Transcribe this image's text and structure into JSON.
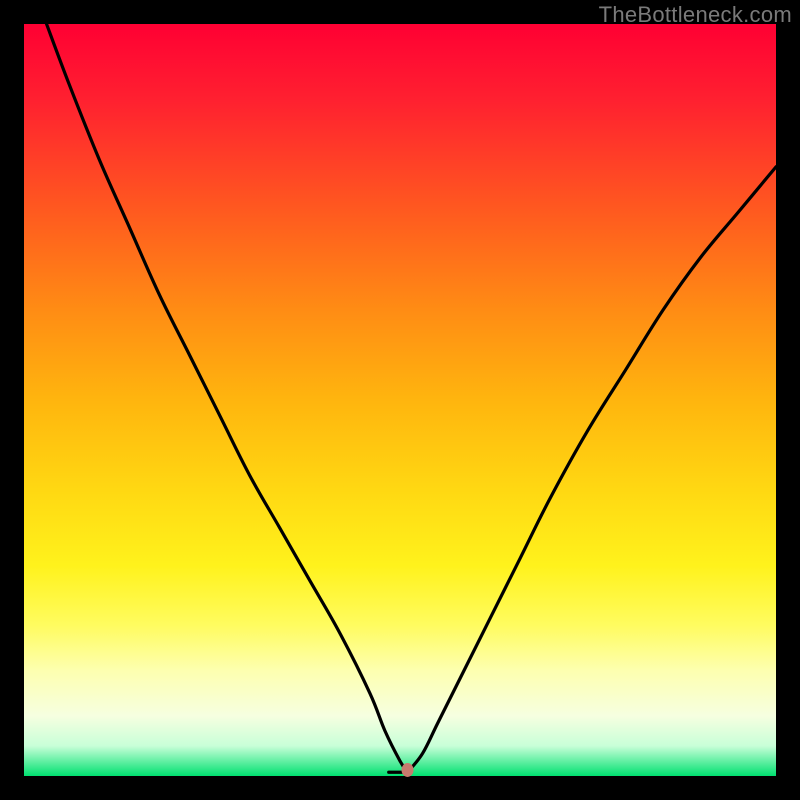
{
  "watermark": "TheBottleneck.com",
  "chart_data": {
    "type": "line",
    "title": "",
    "xlabel": "",
    "ylabel": "",
    "xlim": [
      0,
      100
    ],
    "ylim": [
      0,
      100
    ],
    "grid": false,
    "legend": false,
    "background_gradient": {
      "direction": "vertical",
      "stops": [
        {
          "pos": 0,
          "color": "#ff0033"
        },
        {
          "pos": 25,
          "color": "#ff7a18"
        },
        {
          "pos": 50,
          "color": "#ffc010"
        },
        {
          "pos": 72,
          "color": "#fff21c"
        },
        {
          "pos": 90,
          "color": "#f8ffd0"
        },
        {
          "pos": 100,
          "color": "#00e070"
        }
      ]
    },
    "series": [
      {
        "name": "bottleneck-curve-left",
        "x": [
          3,
          6,
          10,
          14,
          18,
          22,
          26,
          30,
          34,
          38,
          42,
          46,
          48,
          50,
          51
        ],
        "y": [
          100,
          92,
          82,
          73,
          64,
          56,
          48,
          40,
          33,
          26,
          19,
          11,
          6,
          2,
          0.5
        ]
      },
      {
        "name": "bottleneck-curve-right",
        "x": [
          51,
          53,
          55,
          58,
          62,
          66,
          70,
          75,
          80,
          85,
          90,
          95,
          100
        ],
        "y": [
          0.5,
          3,
          7,
          13,
          21,
          29,
          37,
          46,
          54,
          62,
          69,
          75,
          81
        ]
      }
    ],
    "flat_bottom": {
      "x_range": [
        48.5,
        51
      ],
      "y": 0.5
    },
    "marker": {
      "x": 51,
      "y": 0.8,
      "color": "#c77a6e"
    }
  }
}
